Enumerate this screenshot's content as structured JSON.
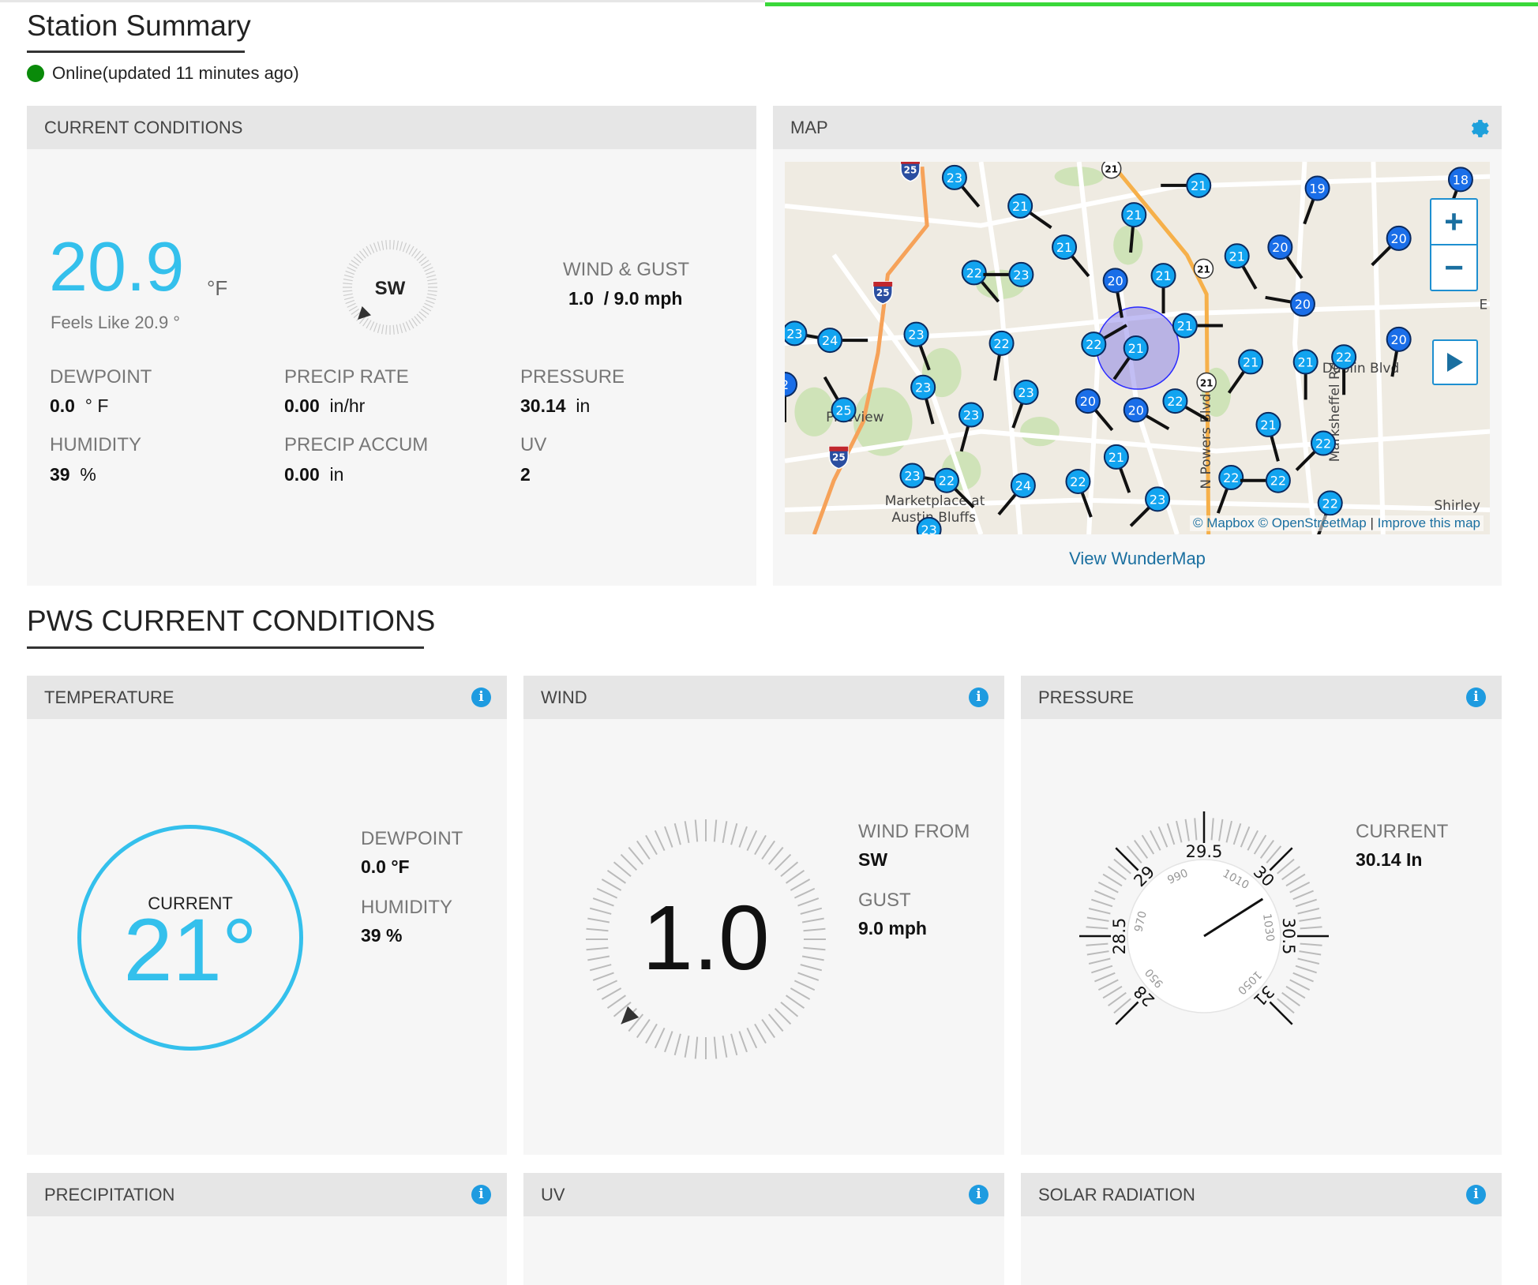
{
  "page": {
    "title": "Station Summary",
    "status_text": "Online(updated 11 minutes ago)",
    "status_color": "#0a8a0a"
  },
  "current_conditions": {
    "header": "CURRENT CONDITIONS",
    "temperature": "20.9",
    "temperature_unit": "°F",
    "feels_like": "Feels Like 20.9 °",
    "wind_direction": "SW",
    "wind_gust_label": "WIND & GUST",
    "wind_gust_value": "1.0  / 9.0 mph",
    "dewpoint": {
      "label": "DEWPOINT",
      "value": "0.0",
      "unit": "° F"
    },
    "humidity": {
      "label": "HUMIDITY",
      "value": "39",
      "unit": "%"
    },
    "precip_rate": {
      "label": "PRECIP RATE",
      "value": "0.00",
      "unit": "in/hr"
    },
    "precip_accum": {
      "label": "PRECIP ACCUM",
      "value": "0.00",
      "unit": "in"
    },
    "pressure": {
      "label": "PRESSURE",
      "value": "30.14",
      "unit": "in"
    },
    "uv": {
      "label": "UV",
      "value": "2"
    },
    "accent_color": "#34c0ec"
  },
  "map": {
    "header": "MAP",
    "settings_icon": "gear-icon",
    "zoom_in": "+",
    "zoom_out": "−",
    "play_icon": "play-icon",
    "attribution_mapbox": "© Mapbox",
    "attribution_osm": "© OpenStreetMap",
    "attribution_sep": "|",
    "improve_link": "Improve this map",
    "view_link": "View WunderMap",
    "place_labels": [
      "Pikeview",
      "Marketplace at",
      "Austin Bluffs",
      "Dublin Blvd",
      "Marksheffel Rd",
      "N Powers Blvd",
      "Shirley",
      "E"
    ],
    "route_shields": [
      "25",
      "25",
      "25",
      "21",
      "21",
      "21"
    ],
    "station_markers": [
      "23",
      "21",
      "21",
      "19",
      "18",
      "21",
      "21",
      "20",
      "20",
      "22",
      "23",
      "20",
      "21",
      "21",
      "20",
      "21",
      "23",
      "24",
      "23",
      "22",
      "22",
      "21",
      "20",
      "22",
      "21",
      "21",
      "23",
      "23",
      "20",
      "20",
      "22",
      "25",
      "23",
      "21",
      "22",
      "21",
      "23",
      "22",
      "24",
      "22",
      "22",
      "22",
      "23",
      "22",
      "23",
      "2"
    ]
  },
  "pws": {
    "title": "PWS CURRENT CONDITIONS",
    "temperature": {
      "header": "TEMPERATURE",
      "current_label": "CURRENT",
      "current_value": "21°",
      "dewpoint_label": "DEWPOINT",
      "dewpoint_value": "0.0 °F",
      "humidity_label": "HUMIDITY",
      "humidity_value": "39 %"
    },
    "wind": {
      "header": "WIND",
      "speed": "1.0",
      "from_label": "WIND FROM",
      "from_value": "SW",
      "gust_label": "GUST",
      "gust_value": "9.0 mph",
      "direction_deg": 225
    },
    "pressure": {
      "header": "PRESSURE",
      "current_label": "CURRENT",
      "current_value": "30.14 In",
      "gauge_value_inhg": 30.14,
      "inhg_labels": [
        "28",
        "28.5",
        "29",
        "29.5",
        "30",
        "30.5",
        "31"
      ],
      "hpa_labels": [
        "950",
        "970",
        "990",
        "1010",
        "1030",
        "1050"
      ]
    },
    "precipitation": {
      "header": "PRECIPITATION"
    },
    "uv": {
      "header": "UV"
    },
    "solar": {
      "header": "SOLAR RADIATION"
    },
    "info_icon": "i"
  }
}
